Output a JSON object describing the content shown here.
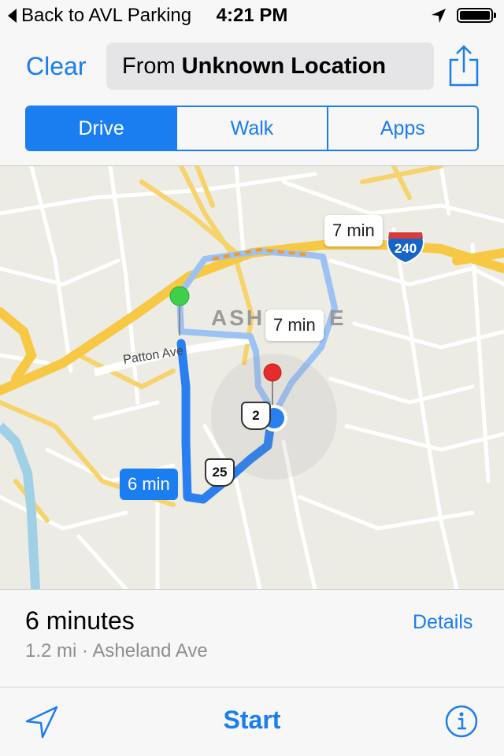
{
  "status_bar": {
    "back_label": "Back to AVL Parking",
    "time": "4:21 PM",
    "location_icon": "location-arrow-icon",
    "battery_icon": "battery-full-icon"
  },
  "nav": {
    "clear_label": "Clear",
    "from_prefix": "From",
    "from_location": "Unknown Location",
    "share_icon": "share-icon"
  },
  "modes": [
    {
      "label": "Drive",
      "selected": true
    },
    {
      "label": "Walk",
      "selected": false
    },
    {
      "label": "Apps",
      "selected": false
    }
  ],
  "map": {
    "town_label": "ASHE",
    "town_label_end": "E",
    "street_label": "Patton Ave",
    "route_shields": {
      "us_partial": "2",
      "us_25": "25",
      "interstate": "240"
    },
    "callouts": {
      "selected_route": "6 min",
      "alternate_route_1": "7 min",
      "alternate_route_2": "7 min"
    }
  },
  "route_summary": {
    "duration": "6 minutes",
    "distance_via": "1.2 mi · Asheland Ave",
    "details_label": "Details"
  },
  "toolbar": {
    "start_label": "Start",
    "tracking_icon": "location-arrow-outline-icon",
    "info_icon": "info-icon"
  },
  "colors": {
    "accent": "#1a7df0",
    "route_primary": "#2a7ff0",
    "route_alternate": "#9cc2f3",
    "traffic": "#f19a2a",
    "highway": "#f7c843",
    "start_pin": "#3ecf4b",
    "end_pin": "#e52b2b",
    "water": "#9fd0e6"
  }
}
